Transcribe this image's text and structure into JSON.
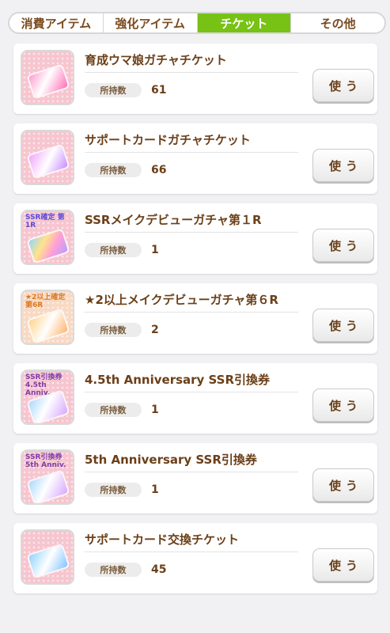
{
  "tabs": [
    {
      "label": "消費アイテム",
      "active": false
    },
    {
      "label": "強化アイテム",
      "active": false
    },
    {
      "label": "チケット",
      "active": true
    },
    {
      "label": "その他",
      "active": false
    }
  ],
  "count_label": "所持数",
  "use_label": "使う",
  "items": [
    {
      "name": "育成ウマ娘ガチャチケット",
      "count": "61",
      "icon": "pink-ticket-icon",
      "badge": ""
    },
    {
      "name": "サポートカードガチャチケット",
      "count": "66",
      "icon": "violet-ticket-icon",
      "badge": ""
    },
    {
      "name": "SSRメイクデビューガチャ第１R",
      "count": "1",
      "icon": "rainbow-ticket-icon",
      "badge": "SSR確定 第1R"
    },
    {
      "name": "★2以上メイクデビューガチャ第６R",
      "count": "2",
      "icon": "gold-ticket-icon",
      "badge": "★2以上確定 第6R"
    },
    {
      "name": "4.5th Anniversary SSR引換券",
      "count": "1",
      "icon": "ssr-exchange-ticket-icon",
      "badge": "SSR引換券 4.5th Anniv."
    },
    {
      "name": "5th Anniversary SSR引換券",
      "count": "1",
      "icon": "ssr-exchange-ticket-icon",
      "badge": "SSR引換券 5th Anniv."
    },
    {
      "name": "サポートカード交換チケット",
      "count": "45",
      "icon": "blue-ticket-icon",
      "badge": ""
    }
  ],
  "colors": {
    "active_tab": "#77c215",
    "text_brown": "#6b3f18",
    "thumb_pink": "#f6c5cf"
  }
}
